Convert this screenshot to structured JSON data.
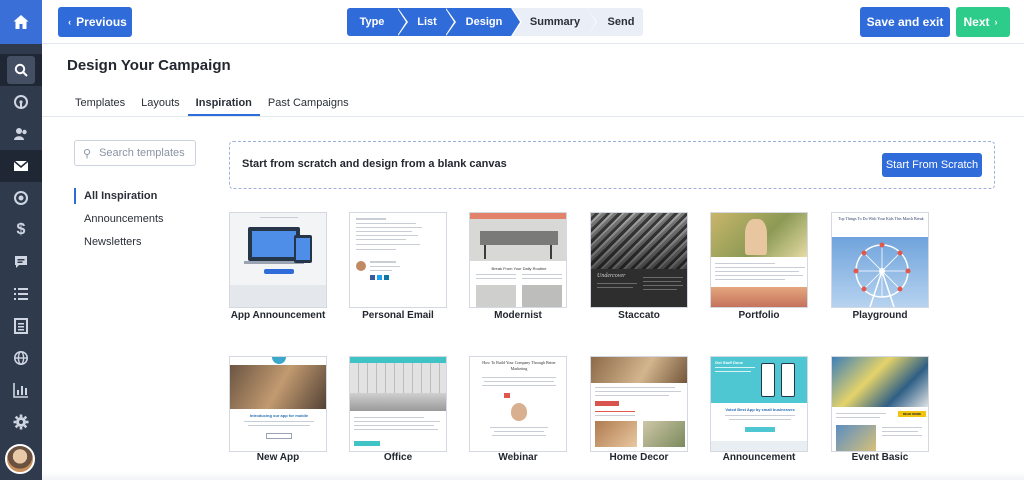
{
  "sidebar": {
    "items": [
      {
        "icon": "search-icon"
      },
      {
        "icon": "speedometer-icon"
      },
      {
        "icon": "contacts-icon"
      },
      {
        "icon": "envelope-icon"
      },
      {
        "icon": "target-icon"
      },
      {
        "icon": "dollar-icon"
      },
      {
        "icon": "chat-icon"
      },
      {
        "icon": "list-icon"
      },
      {
        "icon": "document-icon"
      },
      {
        "icon": "globe-icon"
      },
      {
        "icon": "bar-chart-icon"
      },
      {
        "icon": "gear-icon"
      }
    ],
    "accent": "#3a6fd8",
    "background": "#2f3a4d"
  },
  "topbar": {
    "previous_label": "Previous",
    "save_exit_label": "Save and exit",
    "next_label": "Next",
    "steps": [
      "Type",
      "List",
      "Design",
      "Summary",
      "Send"
    ],
    "current_step": "Design"
  },
  "page": {
    "title": "Design Your Campaign",
    "tabs": [
      "Templates",
      "Layouts",
      "Inspiration",
      "Past Campaigns"
    ],
    "active_tab": "Inspiration"
  },
  "filters": {
    "search_placeholder": "Search templates",
    "items": [
      "All Inspiration",
      "Announcements",
      "Newsletters"
    ],
    "active": "All Inspiration"
  },
  "scratch": {
    "text": "Start from scratch and design from a blank canvas",
    "button_label": "Start From Scratch"
  },
  "templates": [
    {
      "name": "App Announcement"
    },
    {
      "name": "Personal Email"
    },
    {
      "name": "Modernist"
    },
    {
      "name": "Staccato"
    },
    {
      "name": "Portfolio"
    },
    {
      "name": "Playground"
    },
    {
      "name": "New App"
    },
    {
      "name": "Office"
    },
    {
      "name": "Webinar"
    },
    {
      "name": "Home Decor"
    },
    {
      "name": "Announcement"
    },
    {
      "name": "Event Basic"
    }
  ],
  "thumb_text": {
    "playground_title": "Top Things To Do With Your Kids This March Break",
    "modernist_heading": "Break From Your Daily Routine",
    "staccato_heading": "Undercover",
    "webinar_title": "How To Build Your Company Through Better Marketing",
    "new_app_heading": "Introducing our app for mobile",
    "announcement_heading": "Get Stuff Done",
    "announcement_subheading": "Voted Best App by small businesses",
    "event_button": "READ MORE"
  },
  "colors": {
    "primary": "#2f6bd9",
    "next_green": "#2ecc8a",
    "step_inactive": "#e9eef7"
  }
}
